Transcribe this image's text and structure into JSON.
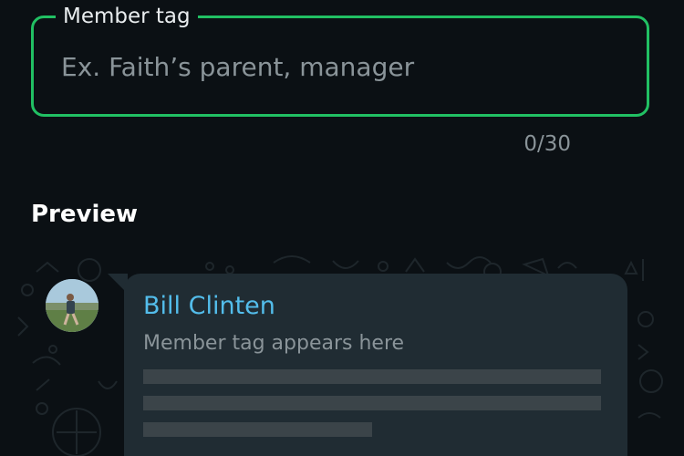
{
  "member_tag": {
    "label": "Member tag",
    "value": "",
    "placeholder": "Ex. Faith’s parent, manager",
    "char_count": "0/30"
  },
  "preview": {
    "title": "Preview",
    "sender_name": "Bill Clinten",
    "member_tag_text": "Member tag appears here"
  },
  "colors": {
    "accent": "#21c063",
    "sender_name": "#53bdeb",
    "background": "#0b1014",
    "bubble": "#202c33"
  }
}
